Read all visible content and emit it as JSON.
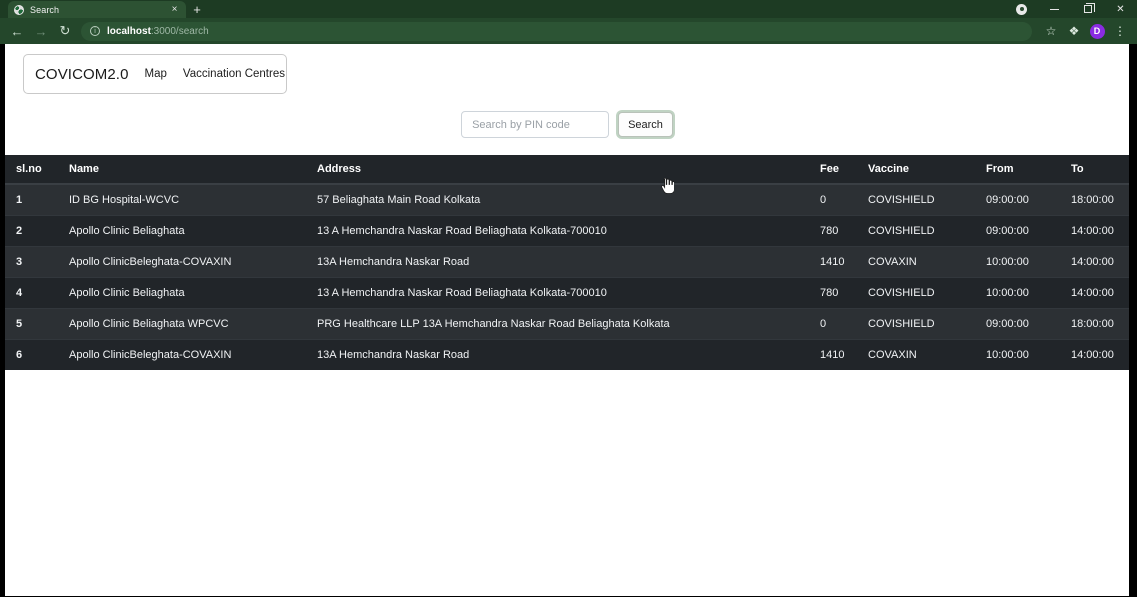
{
  "browser": {
    "tab": {
      "title": "Search",
      "favicon": "globe-icon",
      "close": "×"
    },
    "new_tab": "+",
    "window_controls": {
      "minimize": "–",
      "maximize": "❐",
      "close": "✕"
    },
    "nav": {
      "back": "←",
      "forward": "→",
      "reload": "↻"
    },
    "omnibox": {
      "info_icon": "ⓘ",
      "url_host": "localhost",
      "url_path": ":3000/search"
    },
    "toolbar_icons": {
      "bookmark": "☆",
      "extensions": "❖",
      "profile_initial": "D",
      "menu": "⋮"
    }
  },
  "page": {
    "navbar": {
      "brand": "COVICOM2.0",
      "links": [
        {
          "label": "Map"
        },
        {
          "label": "Vaccination Centres"
        }
      ]
    },
    "search": {
      "placeholder": "Search by PIN code",
      "value": "",
      "button_label": "Search"
    },
    "table": {
      "columns": [
        "sl.no",
        "Name",
        "Address",
        "Fee",
        "Vaccine",
        "From",
        "To"
      ],
      "rows": [
        {
          "sl": "1",
          "name": "ID BG Hospital-WCVC",
          "address": "57 Beliaghata Main Road Kolkata",
          "fee": "0",
          "vaccine": "COVISHIELD",
          "from": "09:00:00",
          "to": "18:00:00"
        },
        {
          "sl": "2",
          "name": "Apollo Clinic Beliaghata",
          "address": "13 A Hemchandra Naskar Road Beliaghata Kolkata-700010",
          "fee": "780",
          "vaccine": "COVISHIELD",
          "from": "09:00:00",
          "to": "14:00:00"
        },
        {
          "sl": "3",
          "name": "Apollo ClinicBeleghata-COVAXIN",
          "address": "13A Hemchandra Naskar Road",
          "fee": "1410",
          "vaccine": "COVAXIN",
          "from": "10:00:00",
          "to": "14:00:00"
        },
        {
          "sl": "4",
          "name": "Apollo Clinic Beliaghata",
          "address": "13 A Hemchandra Naskar Road Beliaghata Kolkata-700010",
          "fee": "780",
          "vaccine": "COVISHIELD",
          "from": "10:00:00",
          "to": "14:00:00"
        },
        {
          "sl": "5",
          "name": "Apollo Clinic Beliaghata WPCVC",
          "address": "PRG Healthcare LLP 13A Hemchandra Naskar Road Beliaghata Kolkata",
          "fee": "0",
          "vaccine": "COVISHIELD",
          "from": "09:00:00",
          "to": "18:00:00"
        },
        {
          "sl": "6",
          "name": "Apollo ClinicBeleghata-COVAXIN",
          "address": "13A Hemchandra Naskar Road",
          "fee": "1410",
          "vaccine": "COVAXIN",
          "from": "10:00:00",
          "to": "14:00:00"
        }
      ]
    }
  },
  "colors": {
    "browser_chrome": "#24472b",
    "tab_active": "#2d5233",
    "table_bg": "#212529",
    "table_row_alt": "#2c3034",
    "profile_badge": "#8a2be2",
    "page_bg": "#ffffff"
  }
}
